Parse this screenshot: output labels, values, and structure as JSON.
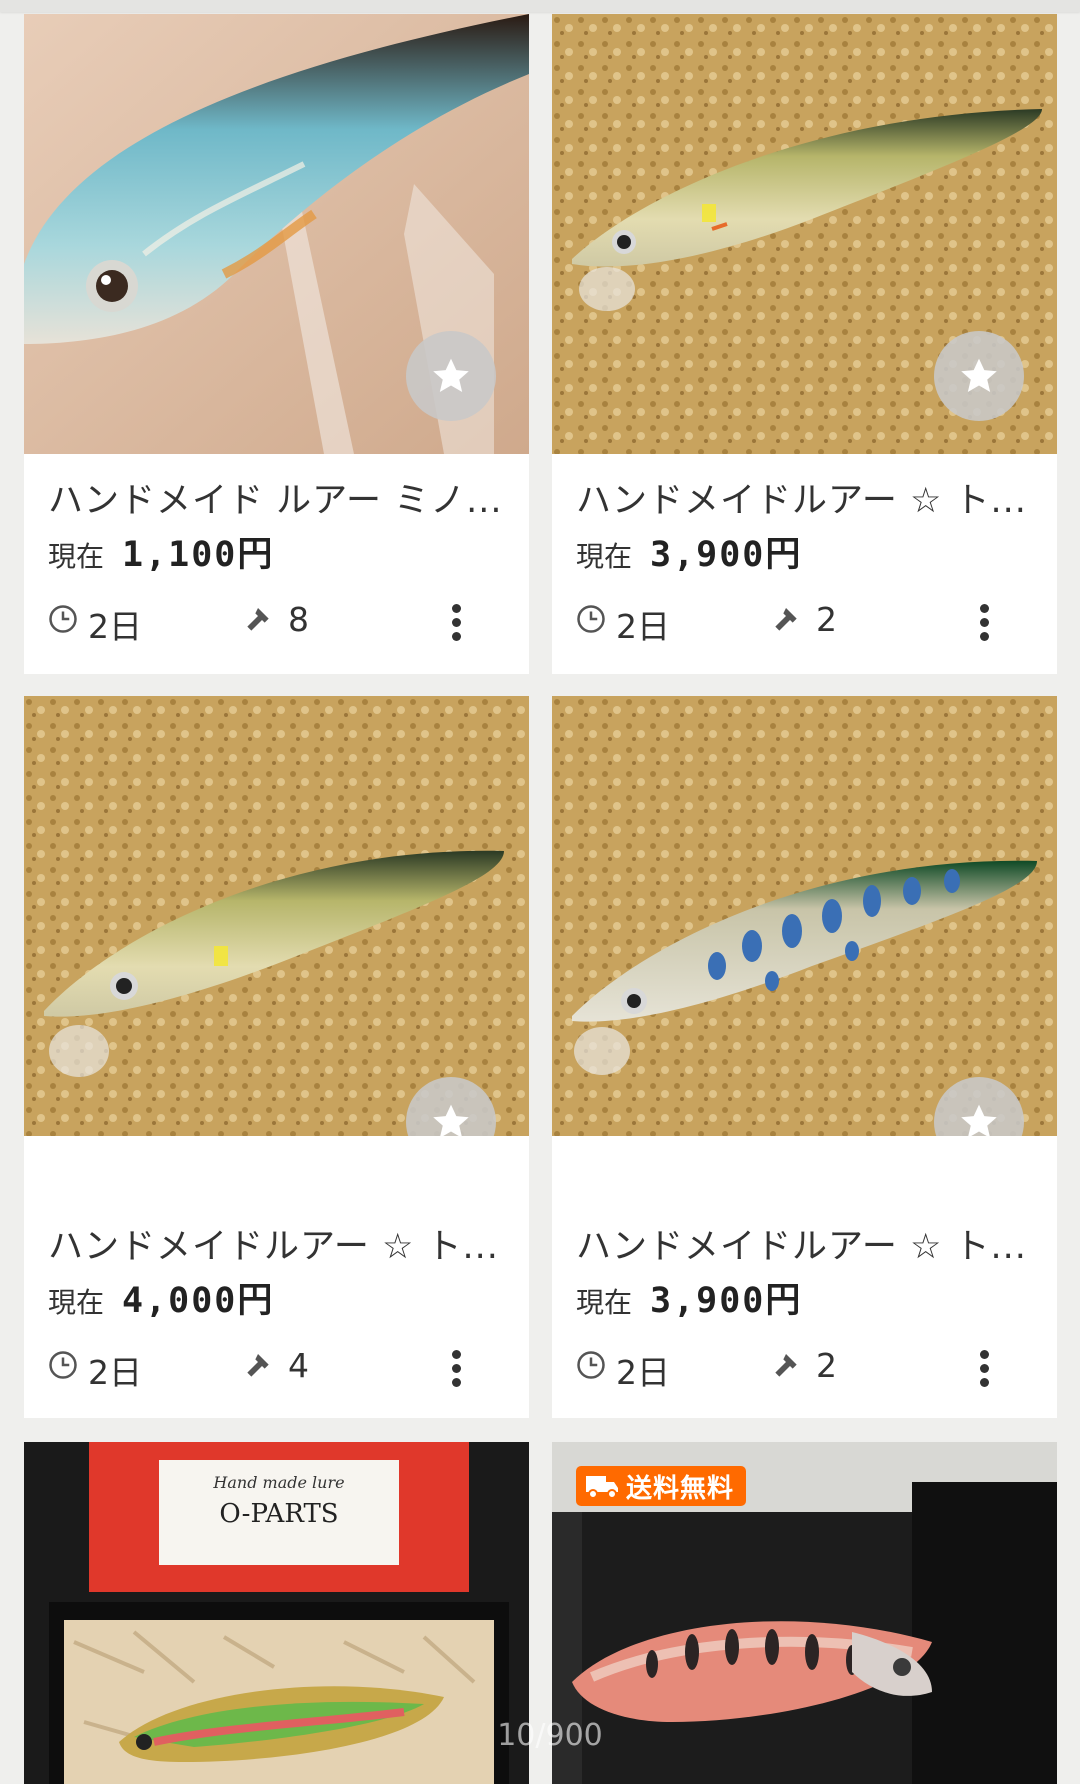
{
  "listings": [
    {
      "title": "ハンドメイド ルアー ミノ...",
      "price_label": "現在",
      "price": "1,100",
      "unit": "円",
      "time_left": "2日",
      "bids": "8",
      "image": "lure-on-acrylic-stand"
    },
    {
      "title": "ハンドメイドルアー ☆ ト...",
      "price_label": "現在",
      "price": "3,900",
      "unit": "円",
      "time_left": "2日",
      "bids": "2",
      "image": "gold-minnow-on-cork"
    },
    {
      "title": "ハンドメイドルアー ☆ ト...",
      "price_label": "現在",
      "price": "4,000",
      "unit": "円",
      "time_left": "2日",
      "bids": "4",
      "image": "gold-minnow-on-cork"
    },
    {
      "title": "ハンドメイドルアー ☆ ト...",
      "price_label": "現在",
      "price": "3,900",
      "unit": "円",
      "time_left": "2日",
      "bids": "2",
      "image": "blue-spotted-minnow-on-cork"
    },
    {
      "image": "rainbow-trout-lure-in-box",
      "box_label_1": "Hand made lure",
      "box_label_2": "O-PARTS"
    },
    {
      "image": "spotted-trout-lure-in-box",
      "badge": "送料無料"
    }
  ],
  "pager": "10/900",
  "colors": {
    "badge": "#ff6a00",
    "fav_button": "#c8c8c8",
    "background": "#efefed"
  },
  "icons": {
    "favorite": "star-icon",
    "time": "clock-icon",
    "bids": "gavel-icon",
    "menu": "more-vert-icon",
    "shipping": "truck-icon"
  }
}
